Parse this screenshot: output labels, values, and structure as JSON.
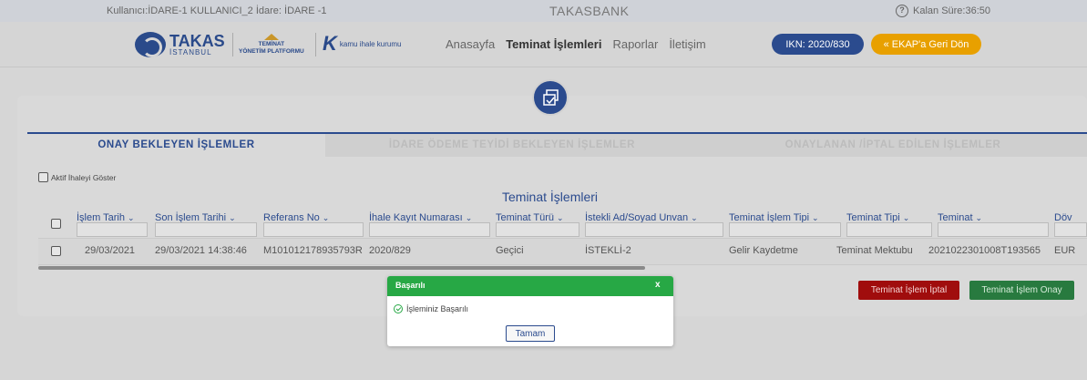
{
  "topbar": {
    "user_info": "Kullanıcı:İDARE-1 KULLANICI_2  İdare: İDARE -1",
    "brand": "TAKASBANK",
    "help_symbol": "?",
    "timer": "Kalan Süre:36:50"
  },
  "logos": {
    "takas_line1": "TAKAS",
    "takas_line2": "İSTANBUL",
    "teminat_line1": "TEMİNAT",
    "teminat_line2": "YÖNETİM PLATFORMU",
    "kamu_k": "K",
    "kamu_text": "kamu ihale kurumu"
  },
  "nav": {
    "items": [
      "Anasayfa",
      "Teminat İşlemleri",
      "Raporlar",
      "İletişim"
    ],
    "active": "Teminat İşlemleri",
    "ikn_label": "IKN: 2020/830",
    "ekap_label": "« EKAP'a Geri Dön"
  },
  "tabs": [
    "ONAY BEKLEYEN İŞLEMLER",
    "İDARE ÖDEME TEYİDİ BEKLEYEN İŞLEMLER",
    "ONAYLANAN /İPTAL EDİLEN İŞLEMLER"
  ],
  "aktif_label": "Aktif İhaleyi Göster",
  "table": {
    "title": "Teminat İşlemleri",
    "columns": [
      "İşlem Tarih",
      "Son İşlem Tarihi",
      "Referans No",
      "İhale Kayıt Numarası",
      "Teminat Türü",
      "İstekli Ad/Soyad Unvan",
      "Teminat İşlem Tipi",
      "Teminat Tipi",
      "Teminat",
      "Döv"
    ],
    "rows": [
      [
        "29/03/2021",
        "29/03/2021 14:38:46",
        "M101012178935793R",
        "2020/829",
        "Geçici",
        "İSTEKLİ-2",
        "Gelir Kaydetme",
        "Teminat Mektubu",
        "2021022301008T193565",
        "EUR"
      ]
    ]
  },
  "buttons": {
    "iptal": "Teminat İşlem İptal",
    "onay": "Teminat İşlem Onay"
  },
  "modal": {
    "title": "Başarılı",
    "close": "x",
    "message": "İşleminiz Başarılı",
    "ok_label": "Tamam"
  },
  "colors": {
    "primary": "#2b4b8e",
    "warning": "#e8a000",
    "success": "#27a845",
    "danger": "#a00d0d"
  }
}
